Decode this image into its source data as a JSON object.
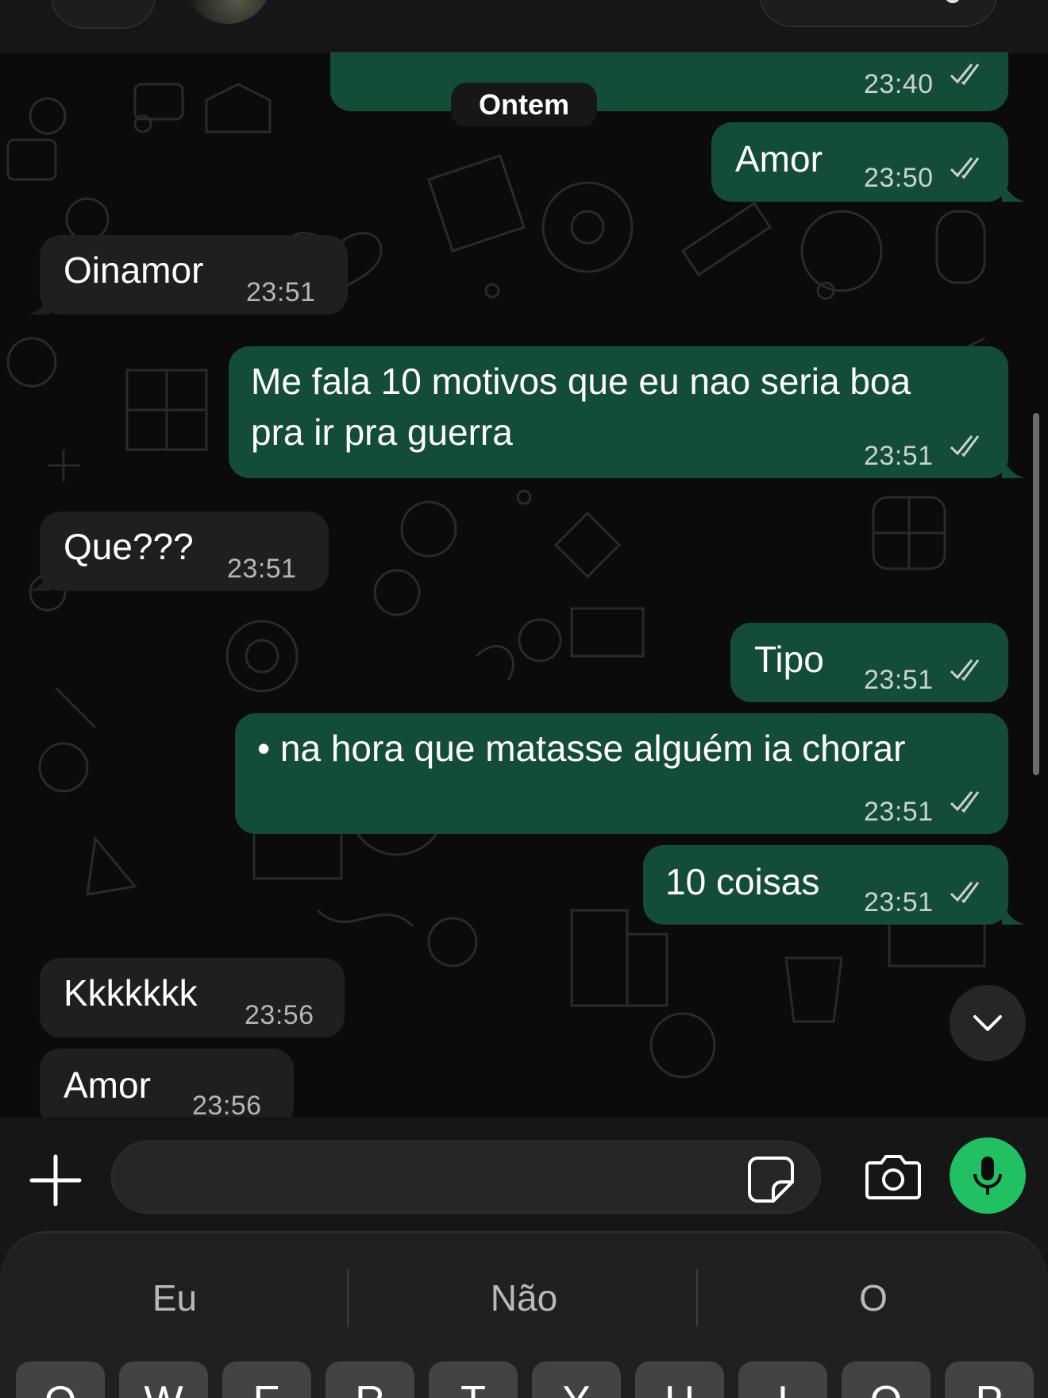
{
  "header": {
    "contact_avatar": "contact-photo"
  },
  "chat": {
    "date_separator": "Ontem",
    "messages": [
      {
        "direction": "out",
        "text": "",
        "time": "23:40",
        "status": "read"
      },
      {
        "direction": "out",
        "text": "Amor",
        "time": "23:50",
        "status": "read"
      },
      {
        "direction": "in",
        "text": "Oinamor",
        "time": "23:51"
      },
      {
        "direction": "out",
        "text_line1": "Me fala 10 motivos que eu nao seria boa",
        "text_line2": "pra ir pra guerra",
        "time": "23:51",
        "status": "read"
      },
      {
        "direction": "in",
        "text": "Que???",
        "time": "23:51"
      },
      {
        "direction": "out",
        "text": "Tipo",
        "time": "23:51",
        "status": "read"
      },
      {
        "direction": "out",
        "text": "•  na hora que matasse alguém ia chorar",
        "time": "23:51",
        "status": "read"
      },
      {
        "direction": "out",
        "text": "10 coisas",
        "time": "23:51",
        "status": "read"
      },
      {
        "direction": "in",
        "text": "Kkkkkkk",
        "time": "23:56"
      },
      {
        "direction": "in",
        "text": "Amor",
        "time": "23:56"
      }
    ]
  },
  "composer": {
    "placeholder": "",
    "value": ""
  },
  "keyboard": {
    "suggestions": [
      "Eu",
      "Não",
      "O"
    ],
    "top_row": [
      "Q",
      "W",
      "E",
      "R",
      "T",
      "Y",
      "U",
      "I",
      "O",
      "P"
    ]
  },
  "colors": {
    "outgoing_bubble": "#144d37",
    "incoming_bubble": "#1f1f1f",
    "mic_button": "#21c063",
    "read_ticks": "#c9d3cd"
  },
  "icons": {
    "plus": "plus-icon",
    "sticker": "sticker-icon",
    "camera": "camera-icon",
    "mic": "microphone-icon",
    "scroll_down": "chevron-down-icon",
    "read_status": "double-check-icon"
  }
}
